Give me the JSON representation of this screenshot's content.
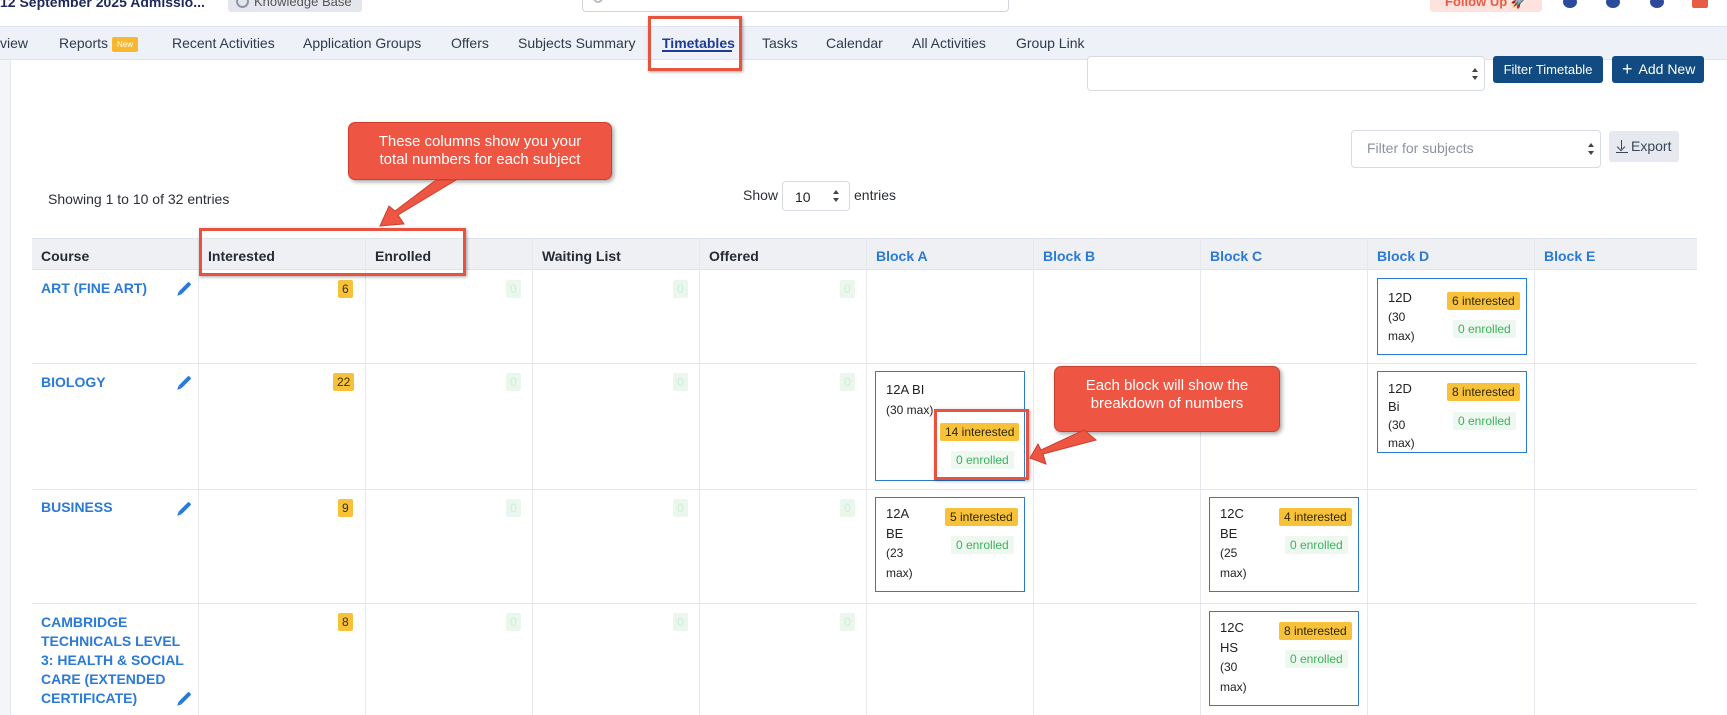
{
  "header": {
    "admission_title": "12 September 2025 Admissio...",
    "knowledge_base_label": "Knowledge Base",
    "follow_up_label": "Follow Up 🚀"
  },
  "nav": {
    "items": [
      "view",
      "Reports",
      "Recent Activities",
      "Application Groups",
      "Offers",
      "Subjects Summary",
      "Timetables",
      "Tasks",
      "Calendar",
      "All Activities",
      "Group Link"
    ],
    "reports_badge": "New",
    "active": "Timetables"
  },
  "toolbar": {
    "filter_timetable_label": "Filter Timetable",
    "add_new_label": "Add New",
    "filter_subjects_placeholder": "Filter for subjects",
    "export_label": "Export"
  },
  "table_info": {
    "showing": "Showing 1 to 10 of 32 entries",
    "show_label": "Show",
    "page_size": "10",
    "entries_label": "entries"
  },
  "columns": [
    "Course",
    "Interested",
    "Enrolled",
    "Waiting List",
    "Offered",
    "Block A",
    "Block B",
    "Block C",
    "Block D",
    "Block E"
  ],
  "rows": [
    {
      "course": "ART (FINE ART)",
      "interested": "6",
      "enrolled": "0",
      "waiting": "0",
      "offered": "0",
      "blocks": [
        {
          "column": "Block D",
          "name_lines": [
            "12D"
          ],
          "max_lines": [
            "(30",
            "max)"
          ],
          "interested": "6 interested",
          "enrolled": "0 enrolled"
        }
      ]
    },
    {
      "course": "BIOLOGY",
      "interested": "22",
      "enrolled": "0",
      "waiting": "0",
      "offered": "0",
      "blocks": [
        {
          "column": "Block A",
          "name_lines": [
            "12A BI"
          ],
          "max_lines": [
            "(30 max)"
          ],
          "interested": "14 interested",
          "enrolled": "0 enrolled"
        },
        {
          "column": "Block D",
          "name_lines": [
            "12D",
            "Bi"
          ],
          "max_lines": [
            "(30",
            "max)"
          ],
          "interested": "8 interested",
          "enrolled": "0 enrolled"
        }
      ]
    },
    {
      "course": "BUSINESS",
      "interested": "9",
      "enrolled": "0",
      "waiting": "0",
      "offered": "0",
      "blocks": [
        {
          "column": "Block A",
          "name_lines": [
            "12A",
            "BE"
          ],
          "max_lines": [
            "(23",
            "max)"
          ],
          "interested": "5 interested",
          "enrolled": "0 enrolled"
        },
        {
          "column": "Block C",
          "name_lines": [
            "12C",
            "BE"
          ],
          "max_lines": [
            "(25",
            "max)"
          ],
          "interested": "4 interested",
          "enrolled": "0 enrolled"
        }
      ]
    },
    {
      "course": "CAMBRIDGE TECHNICALS LEVEL 3: HEALTH & SOCIAL CARE (EXTENDED CERTIFICATE)",
      "course_lines": [
        "CAMBRIDGE",
        "TECHNICALS LEVEL",
        "3: HEALTH & SOCIAL",
        "CARE (EXTENDED",
        "CERTIFICATE)"
      ],
      "interested": "8",
      "enrolled": "0",
      "waiting": "0",
      "offered": "0",
      "blocks": [
        {
          "column": "Block C",
          "name_lines": [
            "12C",
            "HS"
          ],
          "max_lines": [
            "(30",
            "max)"
          ],
          "interested": "8 interested",
          "enrolled": "0 enrolled"
        }
      ]
    }
  ],
  "callouts": {
    "columns_note": "These columns show you your total numbers for each subject",
    "columns_note_lines": [
      "These columns show you your",
      "total numbers for each subject"
    ],
    "block_note": "Each block will show the breakdown of numbers",
    "block_note_lines": [
      "Each block will show the",
      "breakdown of numbers"
    ]
  },
  "colors": {
    "primary": "#114b81",
    "link_blue": "#2a7ad6",
    "badge_yellow": "#f7c23a",
    "enrolled_green": "#3ab25b",
    "callout_red": "#ee5542"
  }
}
